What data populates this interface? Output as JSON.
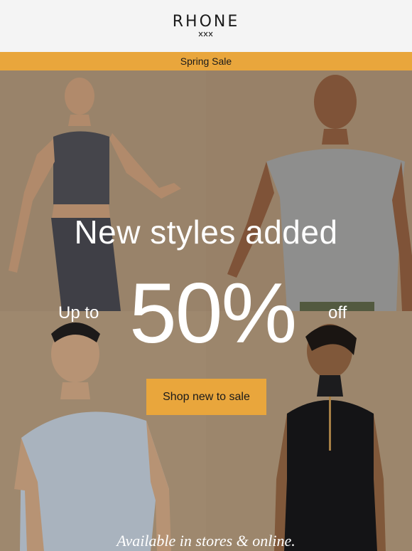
{
  "header": {
    "brand": "RHONE"
  },
  "banner": {
    "label": "Spring Sale"
  },
  "hero": {
    "headline": "New styles added",
    "prefix": "Up to",
    "discount": "50%",
    "suffix": "off",
    "cta_label": "Shop new to sale",
    "tagline": "Available in stores & online."
  },
  "colors": {
    "accent": "#e9a63c",
    "header_bg": "#f4f4f4",
    "hero_bg": "#a78e72"
  }
}
